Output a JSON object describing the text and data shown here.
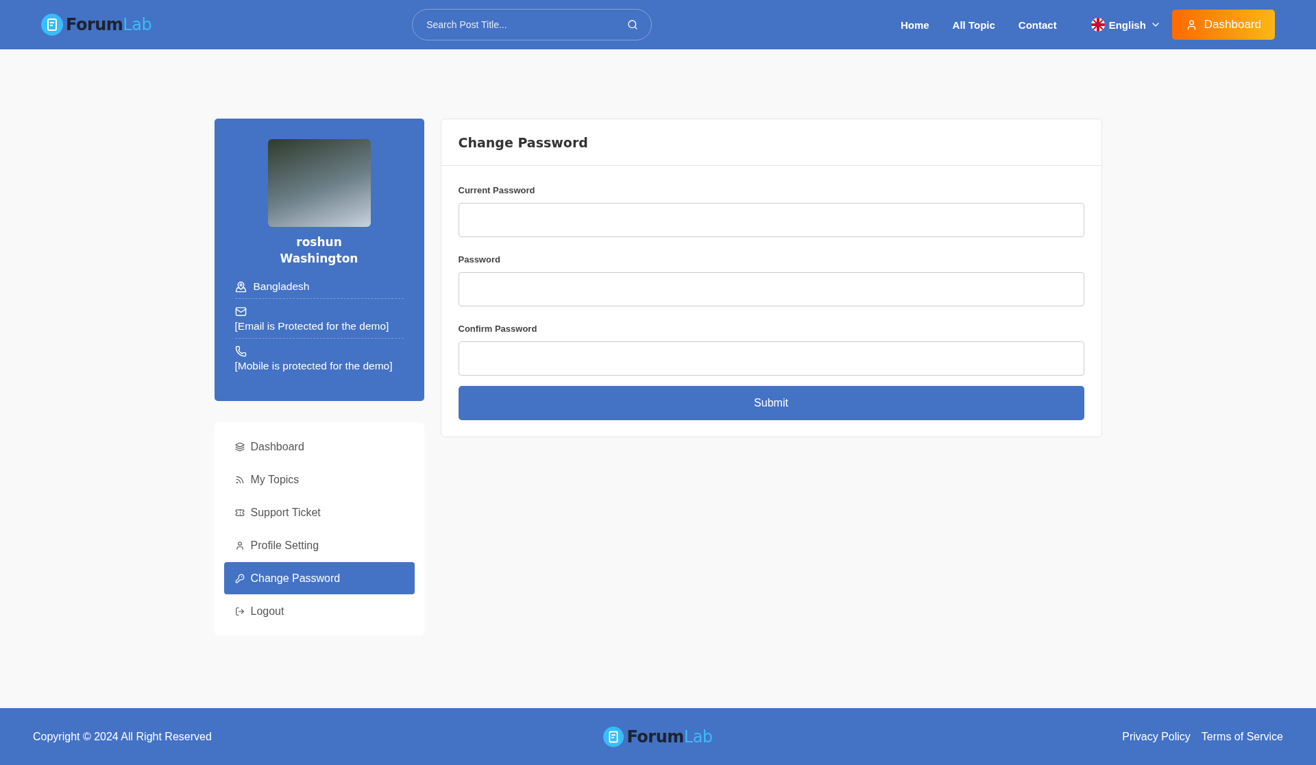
{
  "header": {
    "logo": {
      "primary": "Forum",
      "accent": "Lab"
    },
    "search": {
      "placeholder": "Search Post Title..."
    },
    "nav": [
      "Home",
      "All Topic",
      "Contact"
    ],
    "language": "English",
    "dashboard_button": "Dashboard"
  },
  "profile": {
    "first_name": "roshun",
    "last_name": "Washington",
    "info": [
      {
        "kind": "location",
        "text": "Bangladesh"
      },
      {
        "kind": "email",
        "text": "[Email is Protected for the demo]"
      },
      {
        "kind": "phone",
        "text": "[Mobile is protected for the demo]"
      }
    ]
  },
  "menu": [
    {
      "kind": "dashboard",
      "label": "Dashboard",
      "selected": false
    },
    {
      "kind": "topics",
      "label": "My Topics",
      "selected": false
    },
    {
      "kind": "ticket",
      "label": "Support Ticket",
      "selected": false
    },
    {
      "kind": "profile",
      "label": "Profile Setting",
      "selected": false
    },
    {
      "kind": "password",
      "label": "Change Password",
      "selected": true
    },
    {
      "kind": "logout",
      "label": "Logout",
      "selected": false
    }
  ],
  "form": {
    "title": "Change Password",
    "fields": [
      {
        "label": "Current Password"
      },
      {
        "label": "Password"
      },
      {
        "label": "Confirm Password"
      }
    ],
    "submit": "Submit"
  },
  "footer": {
    "copyright": "Copyright © 2024 All Right Reserved",
    "logo": {
      "primary": "Forum",
      "accent": "Lab"
    },
    "links": [
      "Privacy Policy",
      "Terms of Service"
    ]
  }
}
